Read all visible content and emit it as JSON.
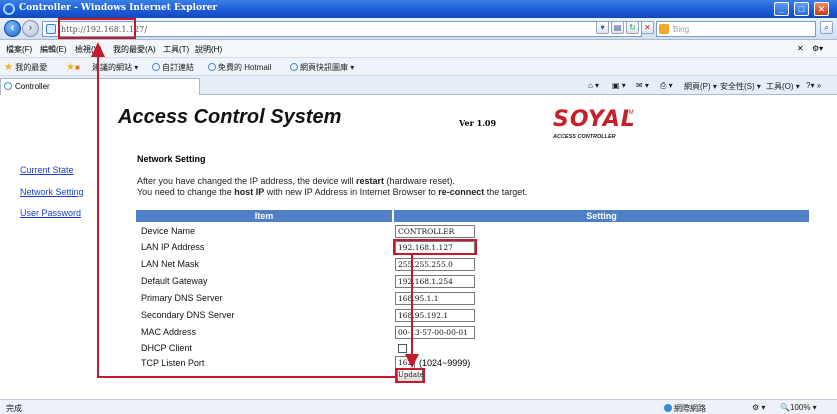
{
  "window": {
    "title": "Controller - Windows Internet Explorer"
  },
  "navbar": {
    "url": "http://192.168.1.127/",
    "search_placeholder": "Bing"
  },
  "menubar": {
    "items": [
      "檔案(F)",
      "編輯(E)",
      "檢視(V)",
      "我的最愛(A)",
      "工具(T)",
      "說明(H)"
    ]
  },
  "favorites": {
    "label": "我的最愛",
    "items": [
      "建議的網站 ▾",
      "自訂連結",
      "免費的 Hotmail",
      "網頁快訊圖庫 ▾"
    ]
  },
  "tab": {
    "label": "Controller"
  },
  "command_bar": {
    "items": [
      "網頁(P) ▾",
      "安全性(S) ▾",
      "工具(O) ▾"
    ]
  },
  "page": {
    "title": "Access Control System",
    "version": "Ver 1.09",
    "logo": {
      "brand": "SOYAL",
      "tm": "TM",
      "sub": "ACCESS CONTROLLER"
    },
    "sidebar": [
      "Current State",
      "Network Setting",
      "User Password"
    ],
    "section_title": "Network Setting",
    "notice_1_pre": "After you have changed the IP address, the device will ",
    "notice_1_bold": "restart",
    "notice_1_post": " (hardware reset).",
    "notice_2_pre": "You need to change the ",
    "notice_2_bold": "host IP",
    "notice_2_mid": " with new IP Address in Internet Browser to ",
    "notice_2_bold2": "re-connect",
    "notice_2_post": " the target.",
    "table": {
      "headers": {
        "item": "Item",
        "setting": "Setting"
      },
      "rows": [
        {
          "label": "Device Name",
          "value": "CONTROLLER"
        },
        {
          "label": "LAN IP Address",
          "value": "192.168.1.127"
        },
        {
          "label": "LAN Net Mask",
          "value": "255.255.255.0"
        },
        {
          "label": "Default Gateway",
          "value": "192.168.1.254"
        },
        {
          "label": "Primary DNS Server",
          "value": "168.95.1.1"
        },
        {
          "label": "Secondary DNS Server",
          "value": "168.95.192.1"
        },
        {
          "label": "MAC Address",
          "value": "00-13-57-00-00-01"
        },
        {
          "label": "DHCP Client",
          "checked": false
        },
        {
          "label": "TCP Listen Port",
          "value": "1621",
          "range": "(1024~9999)"
        }
      ],
      "update_label": "Update"
    }
  },
  "status": {
    "left": "完成",
    "zone": "網際網路",
    "zoom": "100%"
  },
  "annotation_color": "#c41a2a"
}
